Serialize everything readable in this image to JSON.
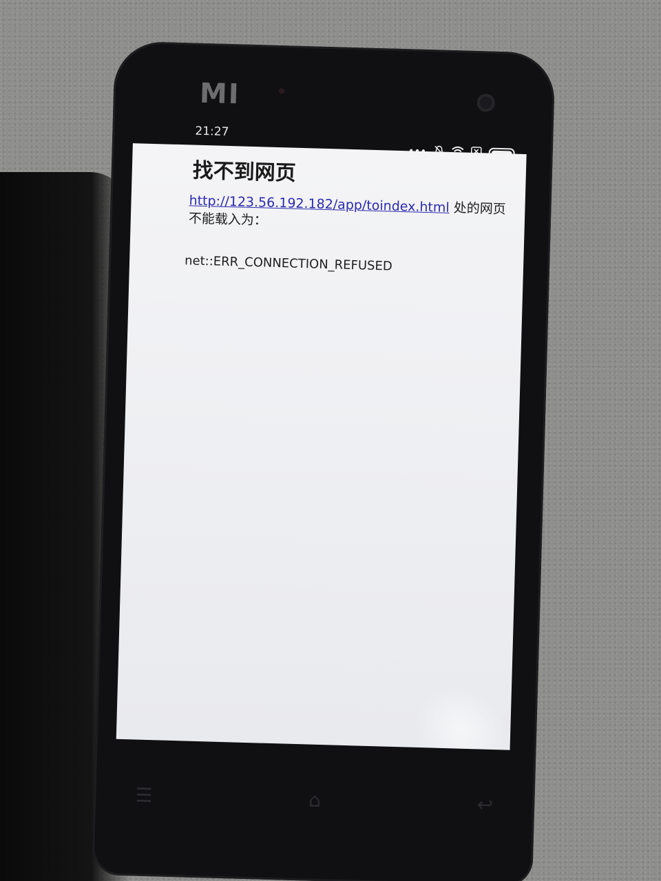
{
  "device": {
    "brand_logo": "MI"
  },
  "status_bar": {
    "time": "21:27",
    "icons": [
      "more-dots-icon",
      "muted-bell-icon",
      "wifi-icon",
      "sim-x-icon",
      "battery-icon"
    ]
  },
  "browser_page": {
    "title": "找不到网页",
    "url": "http://123.56.192.182/app/toindex.html",
    "message_suffix": " 处的网页不能载入为：",
    "error_code": "net::ERR_CONNECTION_REFUSED"
  },
  "nav_bar": {
    "icons": [
      "menu-icon",
      "home-icon",
      "back-icon"
    ]
  },
  "colors": {
    "link": "#2a2ab0",
    "screen_bg": "#f0f1f4",
    "phone_body": "#101012"
  }
}
